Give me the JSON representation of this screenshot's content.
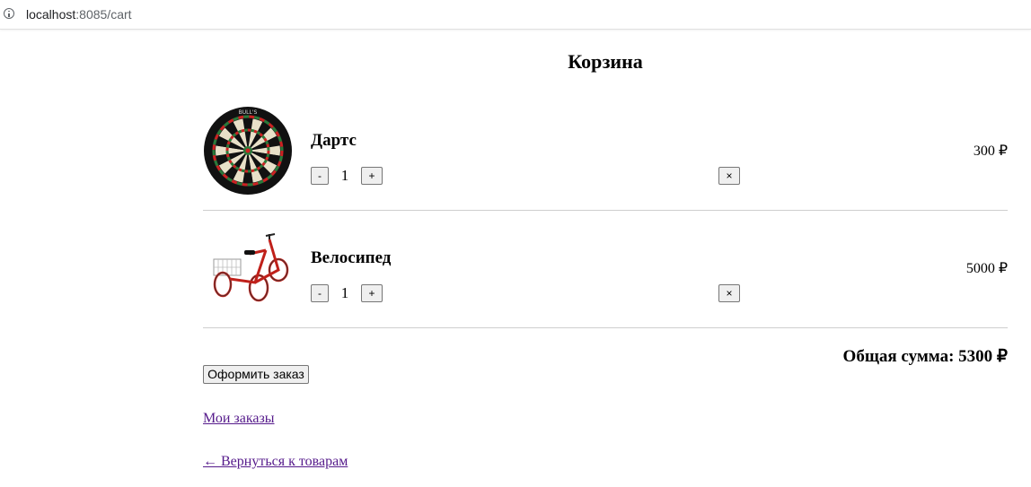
{
  "browser": {
    "url_host": "localhost",
    "url_rest": ":8085/cart"
  },
  "page": {
    "title": "Корзина"
  },
  "cart": {
    "items": [
      {
        "name": "Дартс",
        "quantity": "1",
        "price": "300 ₽",
        "image_icon": "dartboard-image",
        "minus_label": "-",
        "plus_label": "+",
        "remove_label": "×"
      },
      {
        "name": "Велосипед",
        "quantity": "1",
        "price": "5000 ₽",
        "image_icon": "tricycle-image",
        "minus_label": "-",
        "plus_label": "+",
        "remove_label": "×"
      }
    ],
    "total": "Общая сумма: 5300 ₽",
    "checkout_label": "Оформить заказ"
  },
  "links": {
    "my_orders": "Мои заказы",
    "back_to_products": "← Вернуться к товарам"
  },
  "colors": {
    "link_visited": "#551a8b",
    "divider": "#cfcfcf",
    "button_bg": "#efefef"
  }
}
